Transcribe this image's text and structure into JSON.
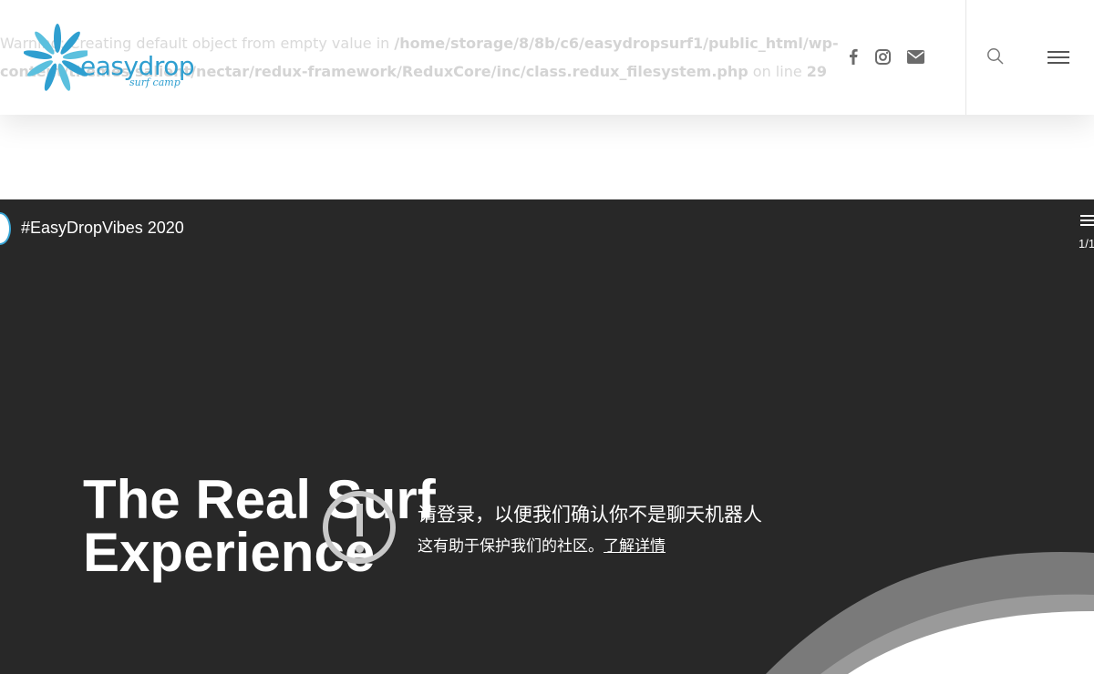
{
  "warning": {
    "prefix": "Warning: Creating default object from empty value in ",
    "path": "/home/storage/8/8b/c6/easydropsurf1/public_html/wp-content/themes/salient/nectar/redux-framework/ReduxCore/inc/class.redux_filesystem.php",
    "middle": " on line ",
    "line": "29"
  },
  "header": {
    "logo_text": "easydrop",
    "logo_sub": "surf camp",
    "social": [
      "facebook-icon",
      "instagram-icon",
      "email-icon"
    ],
    "search_icon": "search-icon",
    "menu_icon": "hamburger-menu-icon"
  },
  "video": {
    "title": "#EasyDropVibes 2020",
    "playlist_count": "1/1",
    "hero_title_line1": "The Real Surf",
    "hero_title_line2": "Experience",
    "error_main": "请登录，以便我们确认你不是聊天机器人",
    "error_sub": "这有助于保护我们的社区。",
    "error_link": "了解详情"
  },
  "colors": {
    "brand": "#2f9fd0",
    "video_bg": "#282828",
    "wave_gray": "#7a7a7a",
    "wave_light": "#d9d9d9"
  }
}
